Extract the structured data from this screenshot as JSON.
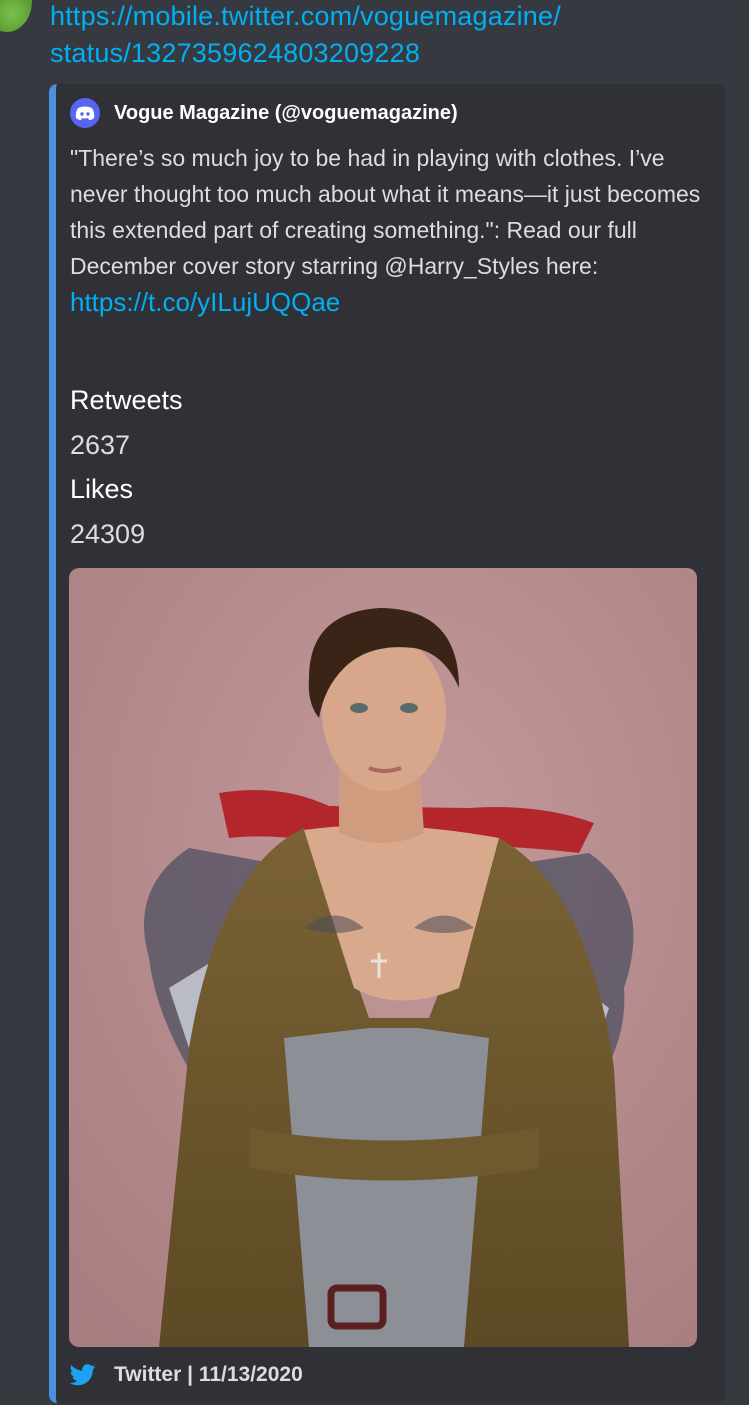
{
  "message": {
    "link_line1": "https://mobile.twitter.com/voguemagazine/",
    "link_line2": "status/1327359624803209228"
  },
  "embed": {
    "accent_color": "#4a90e2",
    "author_icon": "discord-icon",
    "author": "Vogue Magazine (@voguemagazine)",
    "description": "\"There’s so much joy to be had in playing with clothes. I’ve never thought too much about what it means—it just becomes this extended part of creating something.\": Read our full December cover story starring @Harry_Styles here: ",
    "description_link": "https://t.co/yILujUQQae",
    "fields": [
      {
        "name": "Retweets",
        "value": "2637"
      },
      {
        "name": "Likes",
        "value": "24309"
      }
    ],
    "image_subject": "Portrait photo of a man in an olive trench coat with a red ruffled collar against a pink backdrop",
    "footer_icon": "twitter-bird-icon",
    "footer": "Twitter | 11/13/2020"
  }
}
